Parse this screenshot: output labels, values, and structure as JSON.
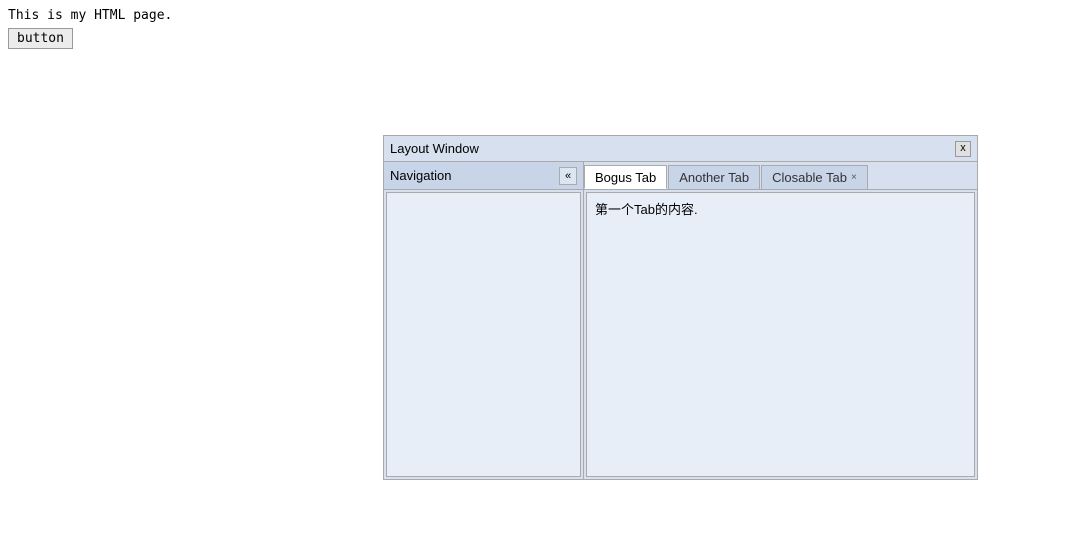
{
  "page": {
    "text": "This is my HTML page.",
    "button_label": "button"
  },
  "window": {
    "title": "Layout Window",
    "close_label": "x",
    "nav": {
      "label": "Navigation",
      "collapse_icon": "«"
    },
    "tabs": [
      {
        "id": "bogus",
        "label": "Bogus Tab",
        "active": true,
        "closable": false
      },
      {
        "id": "another",
        "label": "Another Tab",
        "active": false,
        "closable": false
      },
      {
        "id": "closable",
        "label": "Closable Tab",
        "active": false,
        "closable": true
      }
    ],
    "active_tab_content": "第一个Tab的内容."
  }
}
